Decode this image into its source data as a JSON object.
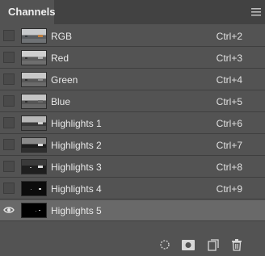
{
  "panel": {
    "tab_label": "Channels",
    "menu_icon": "panel-menu-icon"
  },
  "channels": [
    {
      "label": "RGB",
      "shortcut": "Ctrl+2",
      "visible": false,
      "thumb": "color"
    },
    {
      "label": "Red",
      "shortcut": "Ctrl+3",
      "visible": false,
      "thumb": "gray"
    },
    {
      "label": "Green",
      "shortcut": "Ctrl+4",
      "visible": false,
      "thumb": "gray"
    },
    {
      "label": "Blue",
      "shortcut": "Ctrl+5",
      "visible": false,
      "thumb": "gray"
    },
    {
      "label": "Highlights 1",
      "shortcut": "Ctrl+6",
      "visible": false,
      "thumb": "hl1"
    },
    {
      "label": "Highlights 2",
      "shortcut": "Ctrl+7",
      "visible": false,
      "thumb": "hl2"
    },
    {
      "label": "Highlights 3",
      "shortcut": "Ctrl+8",
      "visible": false,
      "thumb": "hl3"
    },
    {
      "label": "Highlights 4",
      "shortcut": "Ctrl+9",
      "visible": false,
      "thumb": "hl4"
    },
    {
      "label": "Highlights 5",
      "shortcut": "",
      "visible": true,
      "thumb": "hl5",
      "selected": true
    }
  ],
  "footer": {
    "buttons": [
      {
        "icon": "load-selection-icon"
      },
      {
        "icon": "save-selection-mask-icon"
      },
      {
        "icon": "new-channel-icon"
      },
      {
        "icon": "delete-channel-icon"
      }
    ]
  },
  "colors": {
    "panel_bg": "#535353",
    "tab_bar_bg": "#424242",
    "selected_row_bg": "#696969",
    "text": "#e8e8e8"
  }
}
